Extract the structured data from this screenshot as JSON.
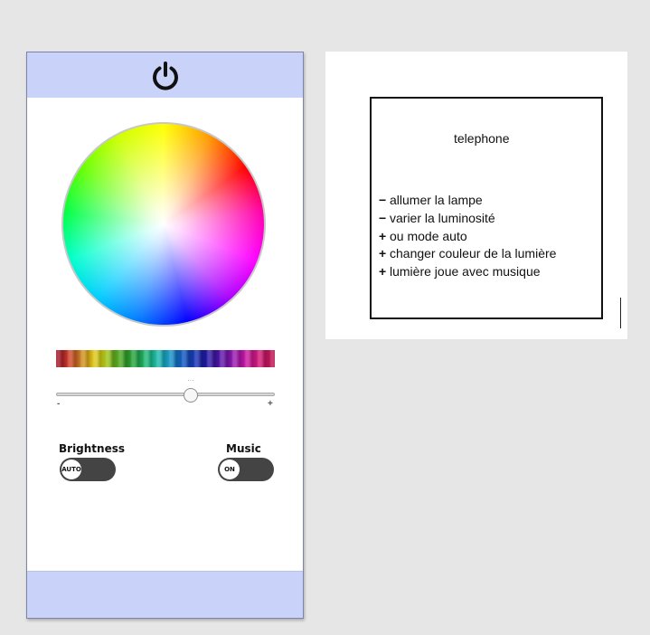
{
  "phone": {
    "header_icon": "power-icon",
    "controls": {
      "slider": {
        "min_label": "-",
        "max_label": "+",
        "value_fraction": 0.62
      },
      "brightness": {
        "label": "Brightness",
        "state": "AUTO"
      },
      "music": {
        "label": "Music",
        "state": "ON"
      }
    }
  },
  "sketch": {
    "title": "telephone",
    "items": [
      {
        "mark": "−",
        "text": "allumer la lampe"
      },
      {
        "mark": "−",
        "text": "varier la luminosité"
      },
      {
        "mark": "+",
        "text": "ou mode auto"
      },
      {
        "mark": "+",
        "text": "changer couleur de la lumière"
      },
      {
        "mark": "+",
        "text": "lumière joue avec musique"
      }
    ]
  }
}
